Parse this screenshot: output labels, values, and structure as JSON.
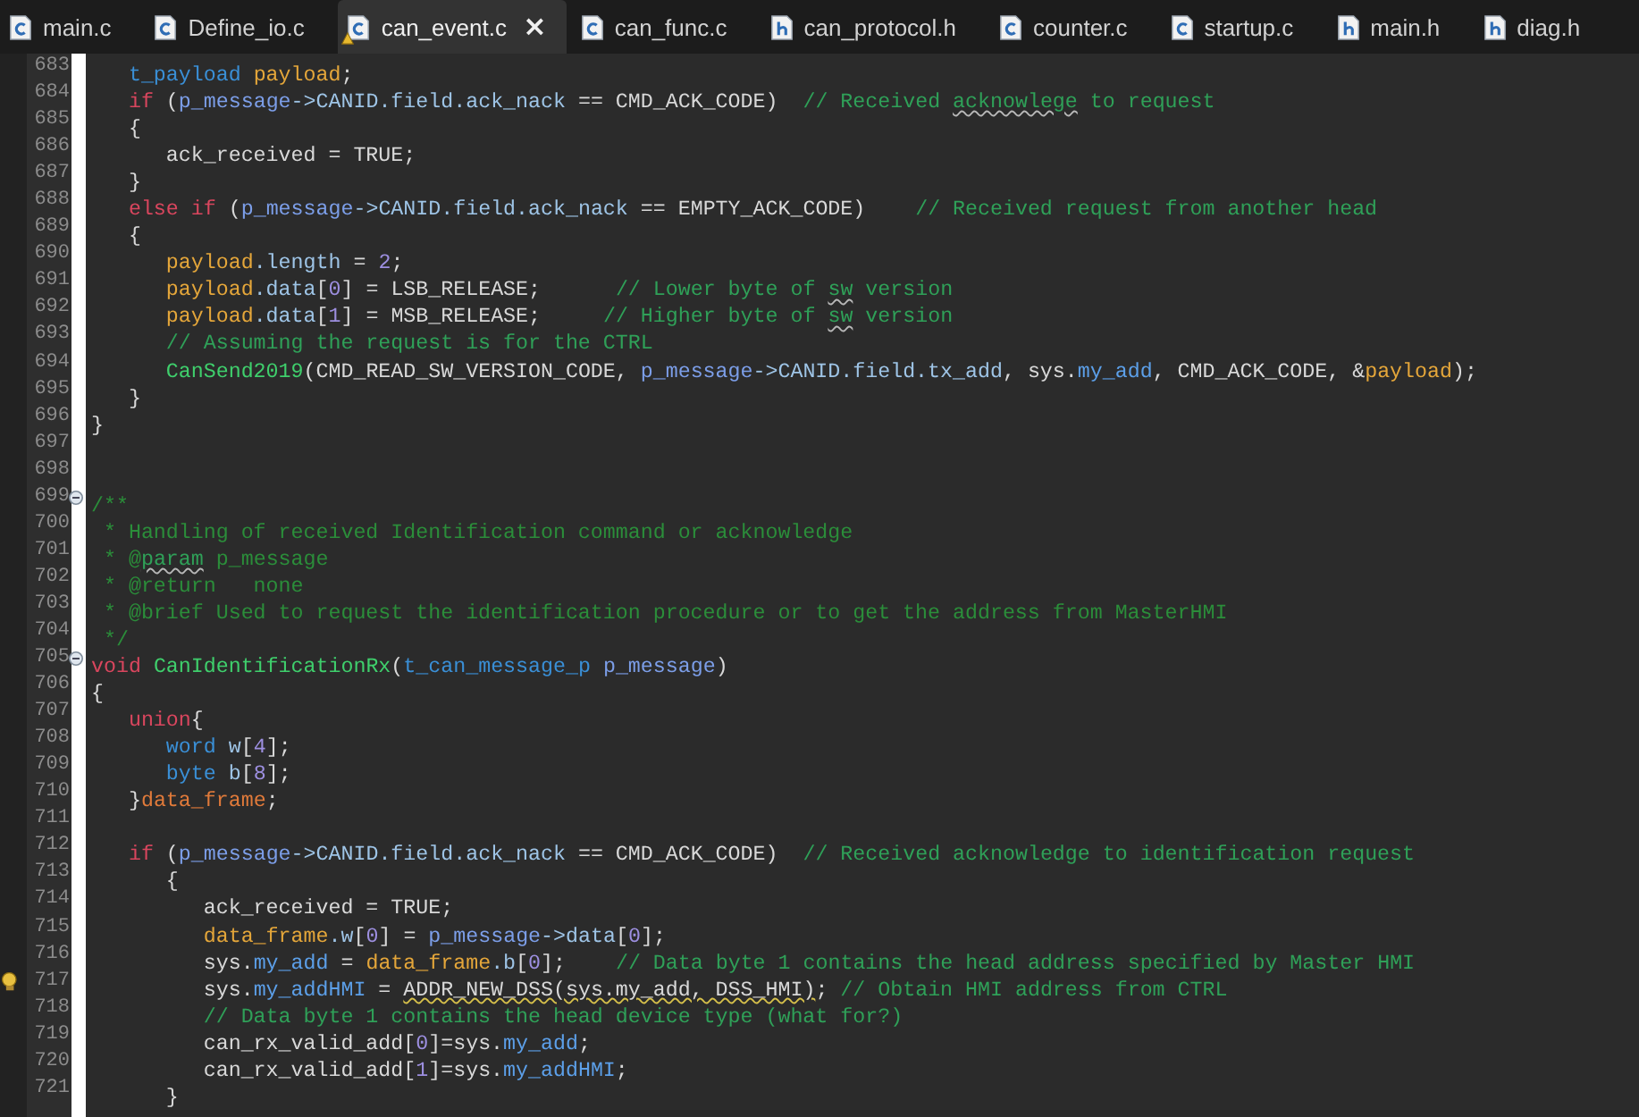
{
  "tabs": [
    {
      "label": "main.c",
      "kind": "c_file",
      "selected": false,
      "warning": false
    },
    {
      "label": "Define_io.c",
      "kind": "c_file",
      "selected": false,
      "warning": false
    },
    {
      "label": "can_event.c",
      "kind": "c_file",
      "selected": true,
      "warning": true,
      "close": "×"
    },
    {
      "label": "can_func.c",
      "kind": "c_file",
      "selected": false,
      "warning": false
    },
    {
      "label": "can_protocol.h",
      "kind": "h_file",
      "selected": false,
      "warning": false
    },
    {
      "label": "counter.c",
      "kind": "c_file",
      "selected": false,
      "warning": false
    },
    {
      "label": "startup.c",
      "kind": "c_file",
      "selected": false,
      "warning": false
    },
    {
      "label": "main.h",
      "kind": "h_file",
      "selected": false,
      "warning": false
    },
    {
      "label": "diag.h",
      "kind": "h_file",
      "selected": false,
      "warning": false
    }
  ],
  "lines": [
    {
      "number": "683",
      "fold": false,
      "warning": false,
      "tokens": [
        {
          "kind": "type",
          "text": "   t_payload "
        },
        {
          "kind": "local",
          "text": "payload"
        },
        {
          "kind": "plain",
          "text": ";"
        }
      ]
    },
    {
      "number": "684",
      "fold": false,
      "warning": false,
      "tokens": [
        {
          "kind": "keyword",
          "text": "   if"
        },
        {
          "kind": "plain",
          "text": " ("
        },
        {
          "kind": "param",
          "text": "p_message"
        },
        {
          "kind": "field",
          "text": "->CANID.field.ack_nack"
        },
        {
          "kind": "plain",
          "text": " == CMD_ACK_CODE)  "
        },
        {
          "kind": "comment",
          "text": "// Received "
        },
        {
          "kind": "typo",
          "text": "acknowlege"
        },
        {
          "kind": "comment",
          "text": " to request"
        }
      ]
    },
    {
      "number": "685",
      "fold": false,
      "warning": false,
      "tokens": [
        {
          "kind": "plain",
          "text": "   {"
        }
      ]
    },
    {
      "number": "686",
      "fold": false,
      "warning": false,
      "tokens": [
        {
          "kind": "plain",
          "text": "      ack_received = TRUE;"
        }
      ]
    },
    {
      "number": "687",
      "fold": false,
      "warning": false,
      "tokens": [
        {
          "kind": "plain",
          "text": "   }"
        }
      ]
    },
    {
      "number": "688",
      "fold": false,
      "warning": false,
      "tokens": [
        {
          "kind": "keyword",
          "text": "   else if"
        },
        {
          "kind": "plain",
          "text": " ("
        },
        {
          "kind": "param",
          "text": "p_message"
        },
        {
          "kind": "field",
          "text": "->CANID.field.ack_nack"
        },
        {
          "kind": "plain",
          "text": " == EMPTY_ACK_CODE)    "
        },
        {
          "kind": "comment",
          "text": "// Received request from another head"
        }
      ]
    },
    {
      "number": "689",
      "fold": false,
      "warning": false,
      "tokens": [
        {
          "kind": "plain",
          "text": "   {"
        }
      ]
    },
    {
      "number": "690",
      "fold": false,
      "warning": false,
      "tokens": [
        {
          "kind": "local",
          "text": "      payload"
        },
        {
          "kind": "field",
          "text": ".length"
        },
        {
          "kind": "plain",
          "text": " = "
        },
        {
          "kind": "number",
          "text": "2"
        },
        {
          "kind": "plain",
          "text": ";"
        }
      ]
    },
    {
      "number": "691",
      "fold": false,
      "warning": false,
      "tokens": [
        {
          "kind": "local",
          "text": "      payload"
        },
        {
          "kind": "field",
          "text": ".data"
        },
        {
          "kind": "plain",
          "text": "["
        },
        {
          "kind": "number",
          "text": "0"
        },
        {
          "kind": "plain",
          "text": "] = LSB_RELEASE;      "
        },
        {
          "kind": "comment",
          "text": "// Lower byte of "
        },
        {
          "kind": "typo",
          "text": "sw"
        },
        {
          "kind": "comment",
          "text": " version"
        }
      ]
    },
    {
      "number": "692",
      "fold": false,
      "warning": false,
      "tokens": [
        {
          "kind": "local",
          "text": "      payload"
        },
        {
          "kind": "field",
          "text": ".data"
        },
        {
          "kind": "plain",
          "text": "["
        },
        {
          "kind": "number",
          "text": "1"
        },
        {
          "kind": "plain",
          "text": "] = MSB_RELEASE;     "
        },
        {
          "kind": "comment",
          "text": "// Higher byte of "
        },
        {
          "kind": "typo",
          "text": "sw"
        },
        {
          "kind": "comment",
          "text": " version"
        }
      ]
    },
    {
      "number": "693",
      "fold": false,
      "warning": false,
      "tokens": [
        {
          "kind": "comment",
          "text": "      // Assuming the request is for the CTRL"
        }
      ]
    },
    {
      "number": "694",
      "fold": false,
      "warning": false,
      "tokens": [
        {
          "kind": "func",
          "text": "      CanSend2019"
        },
        {
          "kind": "plain",
          "text": "(CMD_READ_SW_VERSION_CODE, "
        },
        {
          "kind": "param",
          "text": "p_message"
        },
        {
          "kind": "field",
          "text": "->CANID.field.tx_add"
        },
        {
          "kind": "plain",
          "text": ", sys."
        },
        {
          "kind": "global",
          "text": "my_add"
        },
        {
          "kind": "plain",
          "text": ", CMD_ACK_CODE, &"
        },
        {
          "kind": "local",
          "text": "payload"
        },
        {
          "kind": "plain",
          "text": ");"
        }
      ]
    },
    {
      "number": "695",
      "fold": false,
      "warning": false,
      "tokens": [
        {
          "kind": "plain",
          "text": "   }"
        }
      ]
    },
    {
      "number": "696",
      "fold": false,
      "warning": false,
      "tokens": [
        {
          "kind": "plain",
          "text": "}"
        }
      ]
    },
    {
      "number": "697",
      "fold": false,
      "warning": false
    },
    {
      "number": "698",
      "fold": false,
      "warning": false
    },
    {
      "number": "699",
      "fold": true,
      "warning": false,
      "tokens": [
        {
          "kind": "doc",
          "text": "/**"
        }
      ]
    },
    {
      "number": "700",
      "fold": false,
      "warning": false,
      "tokens": [
        {
          "kind": "doc",
          "text": " * Handling of received Identification command or acknowledge"
        }
      ]
    },
    {
      "number": "701",
      "fold": false,
      "warning": false,
      "tokens": [
        {
          "kind": "doc",
          "text": " * @"
        },
        {
          "kind": "typo",
          "text": "param"
        },
        {
          "kind": "doc",
          "text": " p_message"
        }
      ]
    },
    {
      "number": "702",
      "fold": false,
      "warning": false,
      "tokens": [
        {
          "kind": "doc",
          "text": " * @return   none"
        }
      ]
    },
    {
      "number": "703",
      "fold": false,
      "warning": false,
      "tokens": [
        {
          "kind": "doc",
          "text": " * @brief Used to request the identification procedure or to get the address from MasterHMI"
        }
      ]
    },
    {
      "number": "704",
      "fold": false,
      "warning": false,
      "tokens": [
        {
          "kind": "doc",
          "text": " */"
        }
      ]
    },
    {
      "number": "705",
      "fold": true,
      "warning": false,
      "tokens": [
        {
          "kind": "keyword",
          "text": "void "
        },
        {
          "kind": "func",
          "text": "CanIdentificationRx"
        },
        {
          "kind": "plain",
          "text": "("
        },
        {
          "kind": "type",
          "text": "t_can_message_p "
        },
        {
          "kind": "param",
          "text": "p_message"
        },
        {
          "kind": "plain",
          "text": ")"
        }
      ]
    },
    {
      "number": "706",
      "fold": false,
      "warning": false,
      "tokens": [
        {
          "kind": "plain",
          "text": "{"
        }
      ]
    },
    {
      "number": "707",
      "fold": false,
      "warning": false,
      "tokens": [
        {
          "kind": "keyword",
          "text": "   union"
        },
        {
          "kind": "plain",
          "text": "{"
        }
      ]
    },
    {
      "number": "708",
      "fold": false,
      "warning": false,
      "tokens": [
        {
          "kind": "type",
          "text": "      word "
        },
        {
          "kind": "field",
          "text": "w"
        },
        {
          "kind": "plain",
          "text": "["
        },
        {
          "kind": "number",
          "text": "4"
        },
        {
          "kind": "plain",
          "text": "];"
        }
      ]
    },
    {
      "number": "709",
      "fold": false,
      "warning": false,
      "tokens": [
        {
          "kind": "type",
          "text": "      byte "
        },
        {
          "kind": "field",
          "text": "b"
        },
        {
          "kind": "plain",
          "text": "["
        },
        {
          "kind": "number",
          "text": "8"
        },
        {
          "kind": "plain",
          "text": "];"
        }
      ]
    },
    {
      "number": "710",
      "fold": false,
      "warning": false,
      "tokens": [
        {
          "kind": "plain",
          "text": "   }"
        },
        {
          "kind": "local2",
          "text": "data_frame"
        },
        {
          "kind": "plain",
          "text": ";"
        }
      ]
    },
    {
      "number": "711",
      "fold": false,
      "warning": false
    },
    {
      "number": "712",
      "fold": false,
      "warning": false,
      "tokens": [
        {
          "kind": "keyword",
          "text": "   if"
        },
        {
          "kind": "plain",
          "text": " ("
        },
        {
          "kind": "param",
          "text": "p_message"
        },
        {
          "kind": "field",
          "text": "->CANID.field.ack_nack"
        },
        {
          "kind": "plain",
          "text": " == CMD_ACK_CODE)  "
        },
        {
          "kind": "comment",
          "text": "// Received acknowledge to identification request"
        }
      ]
    },
    {
      "number": "713",
      "fold": false,
      "warning": false,
      "tokens": [
        {
          "kind": "plain",
          "text": "      {"
        }
      ]
    },
    {
      "number": "714",
      "fold": false,
      "warning": false,
      "tokens": [
        {
          "kind": "plain",
          "text": "         ack_received = TRUE;"
        }
      ]
    },
    {
      "number": "715",
      "fold": false,
      "warning": false,
      "tokens": [
        {
          "kind": "local",
          "text": "         data_frame"
        },
        {
          "kind": "field",
          "text": ".w"
        },
        {
          "kind": "plain",
          "text": "["
        },
        {
          "kind": "number",
          "text": "0"
        },
        {
          "kind": "plain",
          "text": "] = "
        },
        {
          "kind": "param",
          "text": "p_message"
        },
        {
          "kind": "field",
          "text": "->data"
        },
        {
          "kind": "plain",
          "text": "["
        },
        {
          "kind": "number",
          "text": "0"
        },
        {
          "kind": "plain",
          "text": "];"
        }
      ]
    },
    {
      "number": "716",
      "fold": false,
      "warning": false,
      "tokens": [
        {
          "kind": "plain",
          "text": "         sys."
        },
        {
          "kind": "global",
          "text": "my_add"
        },
        {
          "kind": "plain",
          "text": " = "
        },
        {
          "kind": "local",
          "text": "data_frame"
        },
        {
          "kind": "field",
          "text": ".b"
        },
        {
          "kind": "plain",
          "text": "["
        },
        {
          "kind": "number",
          "text": "0"
        },
        {
          "kind": "plain",
          "text": "];    "
        },
        {
          "kind": "comment",
          "text": "// Data byte 1 contains the head address specified by Master HMI"
        }
      ]
    },
    {
      "number": "717",
      "fold": false,
      "warning": true,
      "tokens": [
        {
          "kind": "plain",
          "text": "         sys."
        },
        {
          "kind": "global",
          "text": "my_addHMI"
        },
        {
          "kind": "plain",
          "text": " = "
        },
        {
          "kind": "warn",
          "text": "ADDR_NEW_DSS(sys.my_add, DSS_HMI)"
        },
        {
          "kind": "plain",
          "text": "; "
        },
        {
          "kind": "comment",
          "text": "// Obtain HMI address from CTRL"
        }
      ]
    },
    {
      "number": "718",
      "fold": false,
      "warning": false,
      "tokens": [
        {
          "kind": "comment",
          "text": "         // Data byte 1 contains the head device type (what for?)"
        }
      ]
    },
    {
      "number": "719",
      "fold": false,
      "warning": false,
      "tokens": [
        {
          "kind": "plain",
          "text": "         can_rx_valid_add["
        },
        {
          "kind": "number",
          "text": "0"
        },
        {
          "kind": "plain",
          "text": "]=sys."
        },
        {
          "kind": "global",
          "text": "my_add"
        },
        {
          "kind": "plain",
          "text": ";"
        }
      ]
    },
    {
      "number": "720",
      "fold": false,
      "warning": false,
      "tokens": [
        {
          "kind": "plain",
          "text": "         can_rx_valid_add["
        },
        {
          "kind": "number",
          "text": "1"
        },
        {
          "kind": "plain",
          "text": "]=sys."
        },
        {
          "kind": "global",
          "text": "my_addHMI"
        },
        {
          "kind": "plain",
          "text": ";"
        }
      ]
    },
    {
      "number": "721",
      "fold": false,
      "warning": false,
      "tokens": [
        {
          "kind": "plain",
          "text": "      }"
        }
      ]
    }
  ]
}
